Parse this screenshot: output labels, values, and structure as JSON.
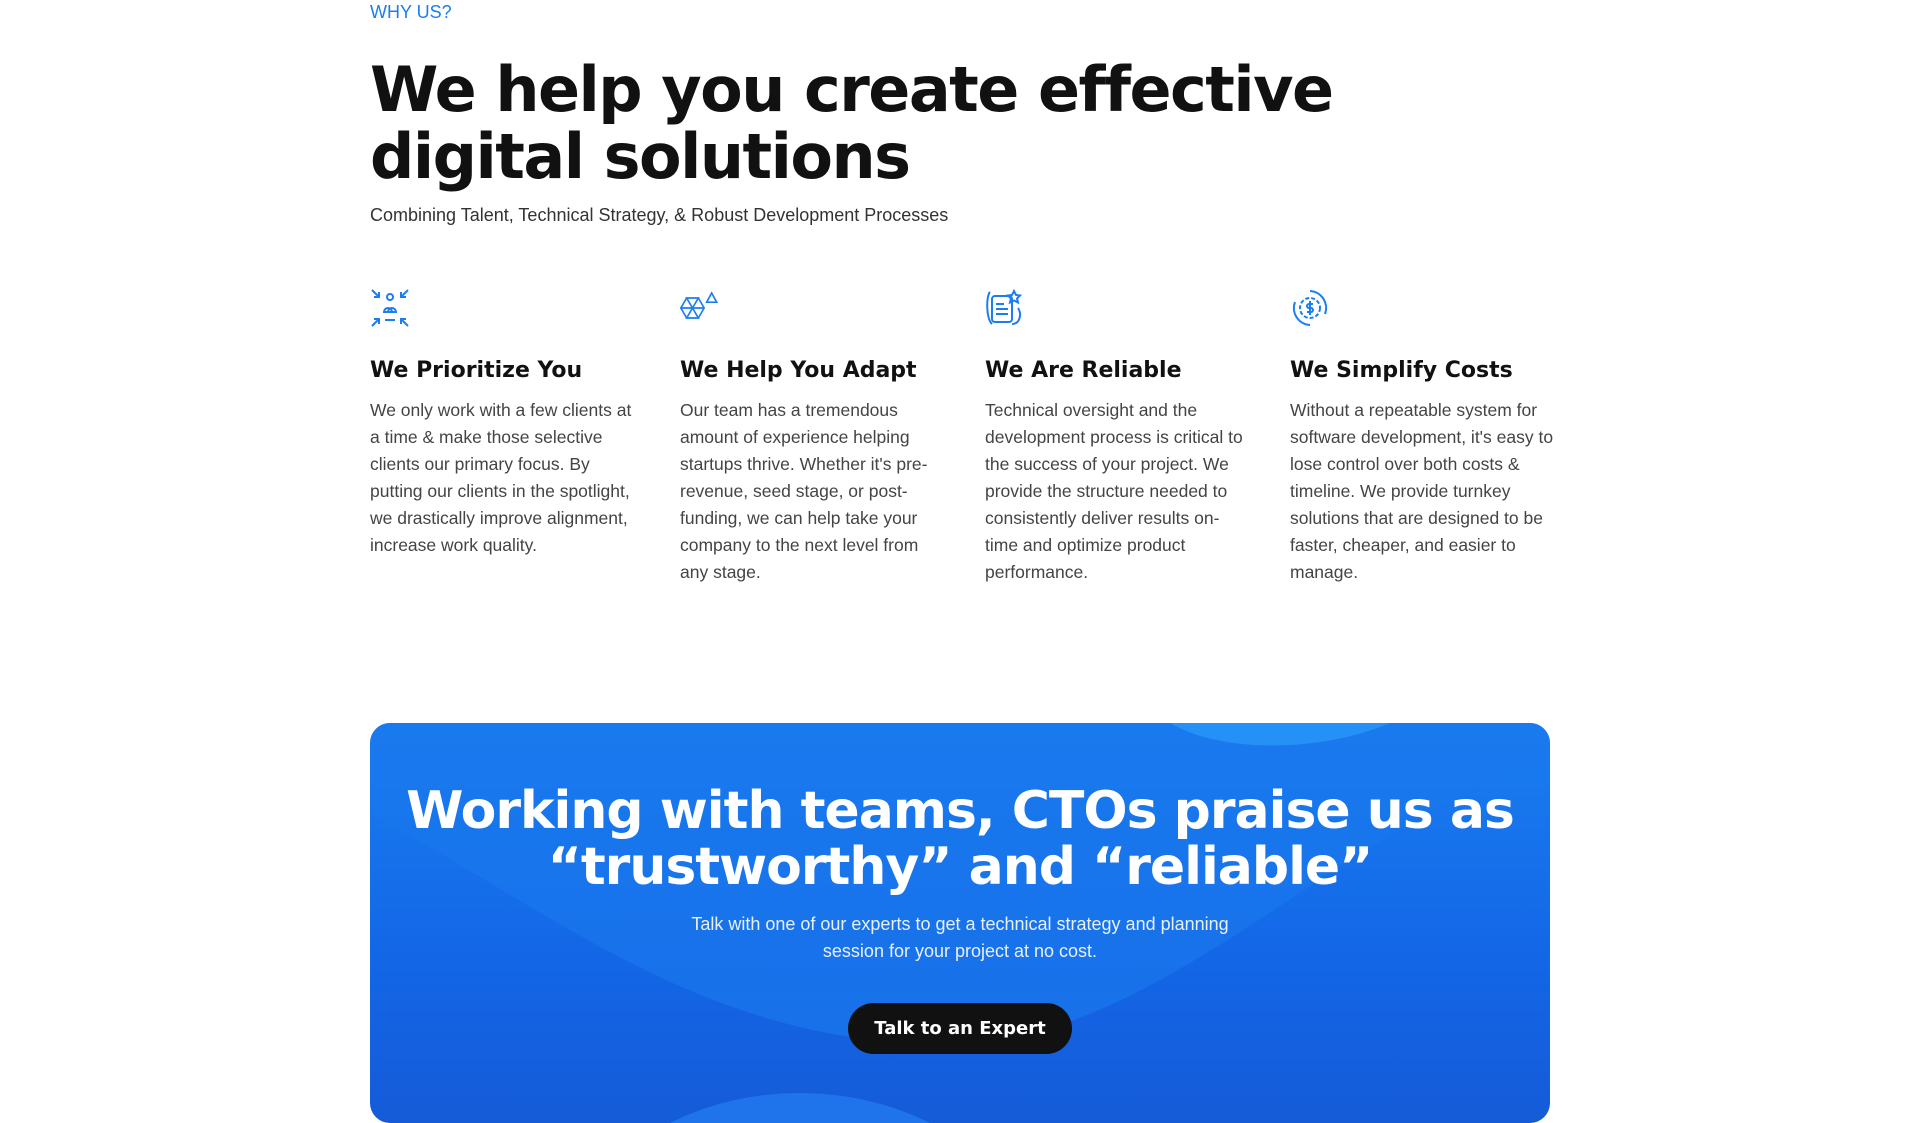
{
  "eyebrow": "WHY US?",
  "title": "We help you create effective digital solutions",
  "subtitle": "Combining Talent, Technical Strategy, & Robust Development Processes",
  "features": [
    {
      "icon": "focus-people-icon",
      "title": "We Prioritize You",
      "text": "We only work with a few clients at a time & make those selective clients our primary focus. By putting our clients in the spotlight, we drastically improve alignment, increase work quality."
    },
    {
      "icon": "shapes-adapt-icon",
      "title": "We Help You Adapt",
      "text": "Our team has a tremendous amount of experience helping startups thrive. Whether it's pre-revenue, seed stage, or post-funding, we can help take your company to the next level from any stage."
    },
    {
      "icon": "document-star-icon",
      "title": "We Are Reliable",
      "text": "Technical oversight and the development process is critical to the success of your project. We provide the structure needed to consistently deliver results on-time and optimize product performance."
    },
    {
      "icon": "dollar-gear-cycle-icon",
      "title": "We Simplify Costs",
      "text": "Without a repeatable system for software development, it's easy to lose control over both costs & timeline. We provide turnkey solutions that are designed to be faster, cheaper, and easier to manage."
    }
  ],
  "cta": {
    "title": "Working with teams, CTOs praise us as “trustworthy” and “reliable”",
    "text": "Talk with one of our experts to get a technical strategy and planning session for your project at no cost.",
    "button": "Talk to an Expert"
  },
  "colors": {
    "accent": "#1a7ef0",
    "button": "#111111"
  }
}
